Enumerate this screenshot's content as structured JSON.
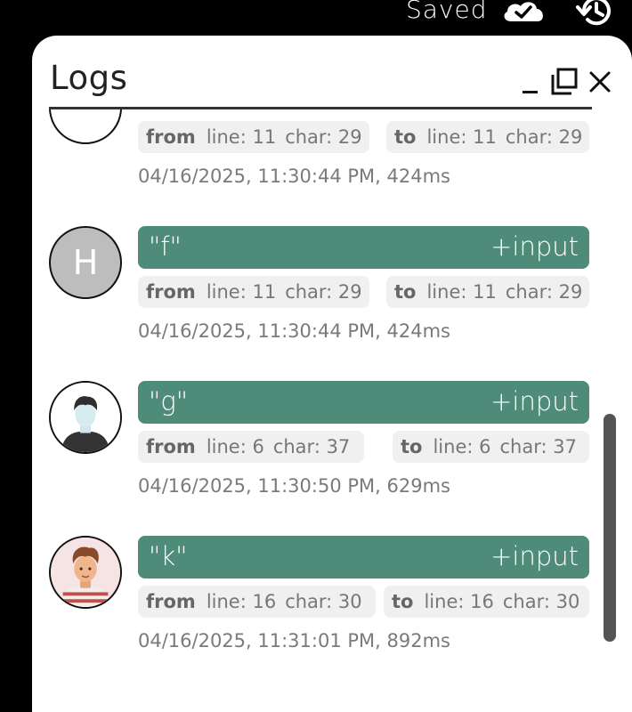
{
  "header": {
    "saved_label": "Saved",
    "icons": [
      "cloud-check-icon",
      "history-icon"
    ]
  },
  "panel": {
    "title": "Logs",
    "window_icons": [
      "minimize-icon",
      "maximize-icon",
      "close-icon"
    ]
  },
  "logs": [
    {
      "avatar_letter": "",
      "text": "",
      "op": "",
      "from_label": "from",
      "from_line": "line: 11",
      "from_char": "char: 29",
      "to_label": "to",
      "to_line": "line: 11",
      "to_char": "char: 29",
      "timestamp": "04/16/2025, 11:30:44 PM, 424ms"
    },
    {
      "avatar_letter": "H",
      "text": "\"f\"",
      "op": "+input",
      "from_label": "from",
      "from_line": "line: 11",
      "from_char": "char: 29",
      "to_label": "to",
      "to_line": "line: 11",
      "to_char": "char: 29",
      "timestamp": "04/16/2025, 11:30:44 PM, 424ms"
    },
    {
      "avatar_letter": "",
      "text": "\"g\"",
      "op": "+input",
      "from_label": "from",
      "from_line": "line: 6",
      "from_char": "char: 37",
      "to_label": "to",
      "to_line": "line: 6",
      "to_char": "char: 37",
      "timestamp": "04/16/2025, 11:30:50 PM, 629ms"
    },
    {
      "avatar_letter": "",
      "text": "\"k\"",
      "op": "+input",
      "from_label": "from",
      "from_line": "line: 16",
      "from_char": "char: 30",
      "to_label": "to",
      "to_line": "line: 16",
      "to_char": "char: 30",
      "timestamp": "04/16/2025, 11:31:01 PM, 892ms"
    }
  ],
  "colors": {
    "accent": "#4e8b78",
    "chip_bg": "#f0f0f0",
    "scrollbar": "#545454"
  }
}
